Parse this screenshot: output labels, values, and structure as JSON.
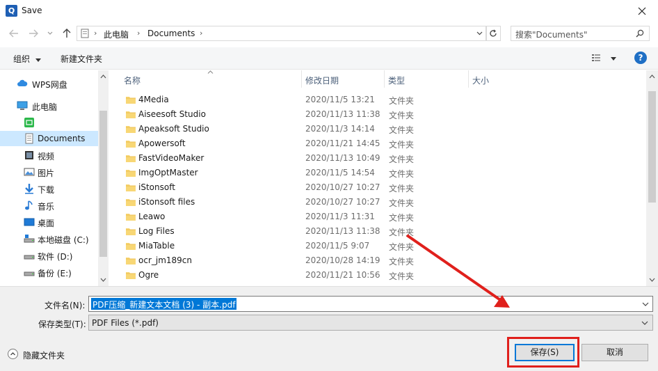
{
  "window": {
    "title": "Save",
    "app_icon": "Q"
  },
  "address": {
    "crumbs": [
      "此电脑",
      "Documents"
    ]
  },
  "search": {
    "placeholder": "搜索\"Documents\""
  },
  "toolbar": {
    "organize": "组织",
    "new_folder": "新建文件夹"
  },
  "sidebar": {
    "items": [
      {
        "label": "WPS网盘",
        "icon": "cloud-icon"
      },
      {
        "label": "此电脑",
        "icon": "computer-icon"
      },
      {
        "label": "",
        "icon": "wps-app-icon"
      },
      {
        "label": "Documents",
        "icon": "document-icon",
        "selected": true
      },
      {
        "label": "视频",
        "icon": "video-icon"
      },
      {
        "label": "图片",
        "icon": "picture-icon"
      },
      {
        "label": "下载",
        "icon": "download-icon"
      },
      {
        "label": "音乐",
        "icon": "music-icon"
      },
      {
        "label": "桌面",
        "icon": "desktop-icon"
      },
      {
        "label": "本地磁盘 (C:)",
        "icon": "drive-icon"
      },
      {
        "label": "软件 (D:)",
        "icon": "drive-icon"
      },
      {
        "label": "备份 (E:)",
        "icon": "drive-icon"
      }
    ]
  },
  "columns": {
    "name": "名称",
    "date": "修改日期",
    "type": "类型",
    "size": "大小"
  },
  "files": [
    {
      "name": "4Media",
      "date": "2020/11/5 13:21",
      "type": "文件夹"
    },
    {
      "name": "Aiseesoft Studio",
      "date": "2020/11/13 11:38",
      "type": "文件夹"
    },
    {
      "name": "Apeaksoft Studio",
      "date": "2020/11/3 14:14",
      "type": "文件夹"
    },
    {
      "name": "Apowersoft",
      "date": "2020/11/21 14:45",
      "type": "文件夹"
    },
    {
      "name": "FastVideoMaker",
      "date": "2020/11/13 10:49",
      "type": "文件夹"
    },
    {
      "name": "ImgOptMaster",
      "date": "2020/11/5 14:54",
      "type": "文件夹"
    },
    {
      "name": "iStonsoft",
      "date": "2020/10/27 10:27",
      "type": "文件夹"
    },
    {
      "name": "iStonsoft files",
      "date": "2020/10/27 10:27",
      "type": "文件夹"
    },
    {
      "name": "Leawo",
      "date": "2020/11/3 11:31",
      "type": "文件夹"
    },
    {
      "name": "Log Files",
      "date": "2020/11/13 11:38",
      "type": "文件夹"
    },
    {
      "name": "MiaTable",
      "date": "2020/11/5 9:07",
      "type": "文件夹"
    },
    {
      "name": "ocr_jm189cn",
      "date": "2020/10/28 14:19",
      "type": "文件夹"
    },
    {
      "name": "Ogre",
      "date": "2020/11/21 10:56",
      "type": "文件夹"
    }
  ],
  "form": {
    "filename_label": "文件名(N):",
    "filename_value": "PDF压缩_新建文本文档 (3) - 副本.pdf",
    "filetype_label": "保存类型(T):",
    "filetype_value": "PDF Files (*.pdf)"
  },
  "footer": {
    "hide_folders": "隐藏文件夹",
    "save": "保存(S)",
    "cancel": "取消"
  },
  "colors": {
    "accent": "#0078d7",
    "selection": "#cce8ff",
    "highlight": "#e0201c",
    "folder": "#f8d775"
  }
}
